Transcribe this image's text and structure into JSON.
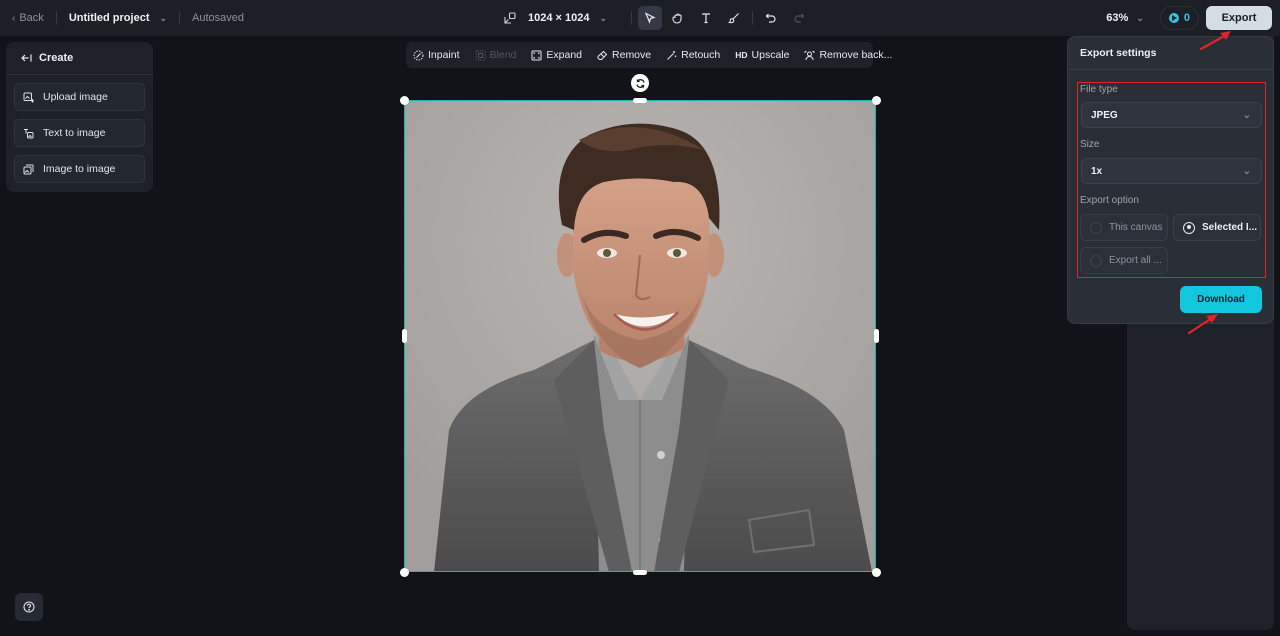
{
  "topbar": {
    "back_label": "Back",
    "project_title": "Untitled project",
    "save_status": "Autosaved",
    "canvas_size": "1024 × 1024",
    "zoom_level": "63%",
    "credits": "0",
    "export_label": "Export"
  },
  "tools": {
    "resize": "resize-icon",
    "select": "select-pointer-icon",
    "hand": "hand-icon",
    "text": "text-icon",
    "brush": "brush-icon",
    "undo": "undo-icon",
    "redo": "redo-icon"
  },
  "create_panel": {
    "title": "Create",
    "items": [
      {
        "label": "Upload image",
        "icon": "upload-image-icon"
      },
      {
        "label": "Text to image",
        "icon": "text-to-image-icon"
      },
      {
        "label": "Image to image",
        "icon": "image-to-image-icon"
      }
    ]
  },
  "edit_toolbar": {
    "items": [
      {
        "label": "Inpaint",
        "enabled": true
      },
      {
        "label": "Blend",
        "enabled": false
      },
      {
        "label": "Expand",
        "enabled": true
      },
      {
        "label": "Remove",
        "enabled": true
      },
      {
        "label": "Retouch",
        "enabled": true
      },
      {
        "label": "Upscale",
        "prefix": "HD",
        "enabled": true
      },
      {
        "label": "Remove back...",
        "enabled": true
      }
    ]
  },
  "export_settings": {
    "title": "Export settings",
    "file_type_label": "File type",
    "file_type_value": "JPEG",
    "size_label": "Size",
    "size_value": "1x",
    "export_option_label": "Export option",
    "options": [
      {
        "label": "This canvas",
        "selected": false
      },
      {
        "label": "Selected I...",
        "selected": true
      },
      {
        "label": "Export all ...",
        "selected": false
      }
    ],
    "download_label": "Download"
  },
  "colors": {
    "accent": "#12c6dd",
    "selection": "#19b8b5",
    "annotation_red": "#e0242c"
  }
}
